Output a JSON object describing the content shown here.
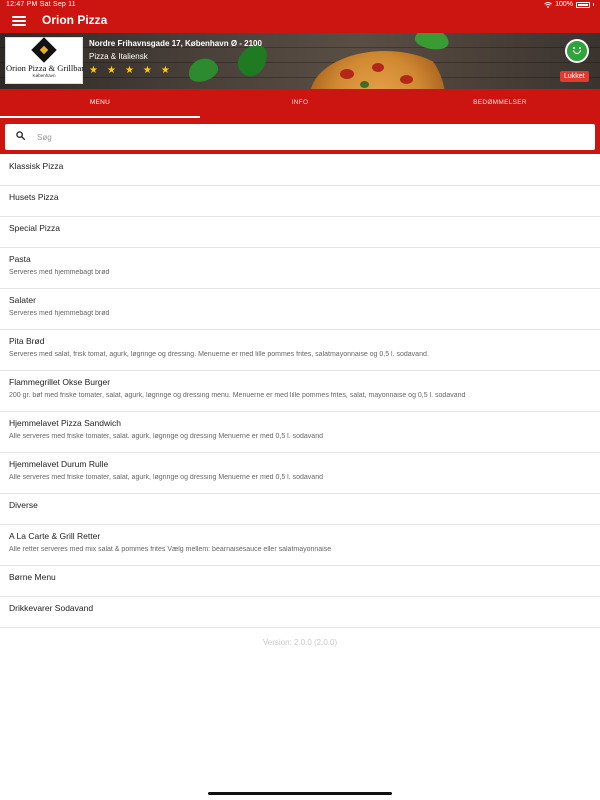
{
  "status_bar": {
    "time_date": "12:47 PM   Sat Sep 11",
    "battery": "100%"
  },
  "app_bar": {
    "title": "Orion Pizza"
  },
  "banner": {
    "logo_name": "Orion Pizza & Grillbar",
    "logo_sub": "København",
    "address": "Nordre Frihavnsgade 17, København Ø - 2100",
    "category": "Pizza & Italiensk",
    "rating": 5,
    "status_badge": "Lukket"
  },
  "tabs": [
    {
      "label": "MENU",
      "active": true
    },
    {
      "label": "INFO",
      "active": false
    },
    {
      "label": "BEDØMMELSER",
      "active": false
    }
  ],
  "search": {
    "placeholder": "Søg",
    "value": ""
  },
  "menu": [
    {
      "title": "Klassisk Pizza",
      "desc": ""
    },
    {
      "title": "Husets Pizza",
      "desc": ""
    },
    {
      "title": "Special Pizza",
      "desc": ""
    },
    {
      "title": "Pasta",
      "desc": "Serveres med hjemmebagt brød"
    },
    {
      "title": "Salater",
      "desc": "Serveres med hjemmebagt brød"
    },
    {
      "title": "Pita Brød",
      "desc": "Serveres med salat, frisk tomat, agurk, løgringe og dressing. Menuerne er med lille pommes frites, salatmayonnaise og 0,5 l. sodavand."
    },
    {
      "title": "Flammegrillet Okse Burger",
      "desc": "200 gr. bøf med friske tomater, salat, agurk, løgringe og dressing menu. Menuerne er med lille pommes frites, salat, mayonnaise og 0,5 l. sodavand"
    },
    {
      "title": "Hjemmelavet Pizza Sandwich",
      "desc": "Alle serveres med friske tomater, salat. agurk, løgringe og dressing Menuerne er med 0,5 l. sodavand"
    },
    {
      "title": "Hjemmelavet Durum Rulle",
      "desc": "Alle serveres med friske tomater, salat, agurk, løgringe og dressing Menuerne er med 0,5 l. sodavand"
    },
    {
      "title": "Diverse",
      "desc": ""
    },
    {
      "title": "A La Carte & Grill Retter",
      "desc": "Alle retter serveres med mix salat & pommes frites Vælg mellem: bearnaisesauce eller salatmayonnaise"
    },
    {
      "title": "Børne Menu",
      "desc": ""
    },
    {
      "title": "Drikkevarer Sodavand",
      "desc": ""
    }
  ],
  "version": "Version: 2.0.0 (2.0.0)",
  "colors": {
    "brand_red": "#cc1510",
    "star": "#ffcc00",
    "closed": "#e23b2e",
    "smiley_green": "#2ea43a"
  }
}
